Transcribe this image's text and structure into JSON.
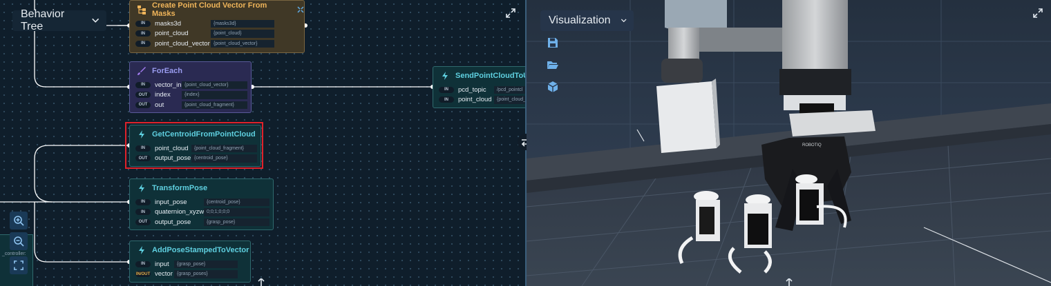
{
  "left_panel": {
    "dropdown_label": "Behavior Tree",
    "controller_label": "_controller:",
    "nodes": [
      {
        "title": "Create Point Cloud Vector From Masks",
        "ports": [
          {
            "dir": "IN",
            "name": "masks3d",
            "value": "{masks3d}"
          },
          {
            "dir": "IN",
            "name": "point_cloud",
            "value": "{point_cloud}"
          },
          {
            "dir": "IN",
            "name": "point_cloud_vector",
            "value": "{point_cloud_vector}"
          }
        ]
      },
      {
        "title": "ForEach",
        "ports": [
          {
            "dir": "IN",
            "name": "vector_in",
            "value": "{point_cloud_vector}"
          },
          {
            "dir": "OUT",
            "name": "index",
            "value": "{index}"
          },
          {
            "dir": "OUT",
            "name": "out",
            "value": "{point_cloud_fragment}"
          }
        ]
      },
      {
        "title": "SendPointCloudToUI",
        "ports": [
          {
            "dir": "IN",
            "name": "pcd_topic",
            "value": "/pcd_pointcl"
          },
          {
            "dir": "IN",
            "name": "point_cloud",
            "value": "{point_cloud_"
          }
        ]
      },
      {
        "title": "GetCentroidFromPointCloud",
        "ports": [
          {
            "dir": "IN",
            "name": "point_cloud",
            "value": "{point_cloud_fragment}"
          },
          {
            "dir": "OUT",
            "name": "output_pose",
            "value": "{centroid_pose}"
          }
        ]
      },
      {
        "title": "TransformPose",
        "ports": [
          {
            "dir": "IN",
            "name": "input_pose",
            "value": "{centroid_pose}"
          },
          {
            "dir": "IN",
            "name": "quaternion_xyzw",
            "value": "0;0;1;0;0;0"
          },
          {
            "dir": "OUT",
            "name": "output_pose",
            "value": "{grasp_pose}"
          }
        ]
      },
      {
        "title": "AddPoseStampedToVector",
        "ports": [
          {
            "dir": "IN",
            "name": "input",
            "value": "{grasp_pose}"
          },
          {
            "dir": "IN/OUT",
            "name": "vector",
            "value": "{grasp_poses}"
          }
        ]
      }
    ],
    "colors": {
      "canvas_bg": "#0f1e2b",
      "highlight": "#e0222a",
      "cloud_node": "#403826",
      "foreach_node": "#2a2a52",
      "action_node": "#0f3138"
    }
  },
  "right_panel": {
    "dropdown_label": "Visualization",
    "icons": [
      "save-icon",
      "folder-open-icon",
      "cube-icon"
    ],
    "gripper_brand": "ROBOTIQ"
  }
}
